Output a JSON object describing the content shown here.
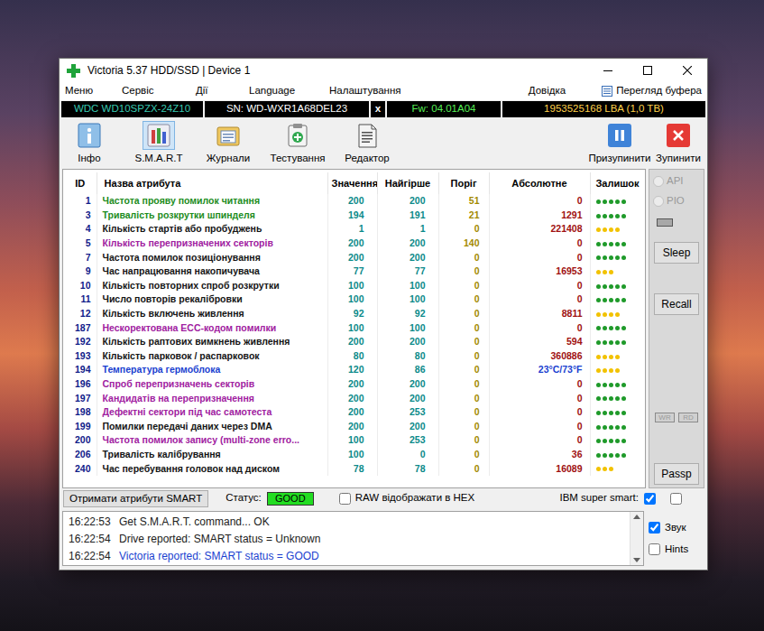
{
  "window": {
    "title": "Victoria 5.37 HDD/SSD | Device 1"
  },
  "menu": {
    "items": [
      "Меню",
      "Сервіс",
      "Дії",
      "Language",
      "Налаштування"
    ],
    "help": "Довідка",
    "buffer": "Перегляд буфера"
  },
  "device": {
    "model": "WDC WD10SPZX-24Z10",
    "serial": "SN: WD-WXR1A68DEL23",
    "close": "x",
    "firmware": "Fw: 04.01A04",
    "capacity": "1953525168 LBA (1,0 TB)"
  },
  "toolbar": {
    "left": [
      {
        "label": "Інфо",
        "selected": false,
        "kind": "info"
      },
      {
        "label": "S.M.A.R.T",
        "selected": true,
        "kind": "smart"
      },
      {
        "label": "Журнали",
        "selected": false,
        "kind": "journal"
      },
      {
        "label": "Тестування",
        "selected": false,
        "kind": "test"
      },
      {
        "label": "Редактор",
        "selected": false,
        "kind": "editor"
      }
    ],
    "right": [
      {
        "label": "Призупинити",
        "kind": "pause"
      },
      {
        "label": "Зупинити",
        "kind": "stop"
      }
    ]
  },
  "table": {
    "columns": [
      "ID",
      "Назва атрибута",
      "Значення",
      "Найгірше",
      "Поріг",
      "Абсолютне",
      "Залишок"
    ],
    "rows": [
      {
        "id": "1",
        "name": "Частота прояву помилок читання",
        "value": "200",
        "worst": "200",
        "threshold": "51",
        "raw": "0",
        "name_color": "#1c8c1c",
        "raw_color": "#a01010",
        "stars": 5,
        "dot_color": "#1f9a2a"
      },
      {
        "id": "3",
        "name": "Тривалість розкрутки шпинделя",
        "value": "194",
        "worst": "191",
        "threshold": "21",
        "raw": "1291",
        "name_color": "#1c8c1c",
        "raw_color": "#a01010",
        "stars": 5,
        "dot_color": "#1f9a2a"
      },
      {
        "id": "4",
        "name": "Кількість стартів або пробуджень",
        "value": "1",
        "worst": "1",
        "threshold": "0",
        "raw": "221408",
        "name_color": "#141414",
        "raw_color": "#a01010",
        "stars": 4,
        "dot_color": "#f2c200"
      },
      {
        "id": "5",
        "name": "Кількість перепризначених секторів",
        "value": "200",
        "worst": "200",
        "threshold": "140",
        "raw": "0",
        "name_color": "#a020a0",
        "raw_color": "#a01010",
        "stars": 5,
        "dot_color": "#1f9a2a"
      },
      {
        "id": "7",
        "name": "Частота помилок позиціонування",
        "value": "200",
        "worst": "200",
        "threshold": "0",
        "raw": "0",
        "name_color": "#141414",
        "raw_color": "#a01010",
        "stars": 5,
        "dot_color": "#1f9a2a"
      },
      {
        "id": "9",
        "name": "Час напрацювання накопичувача",
        "value": "77",
        "worst": "77",
        "threshold": "0",
        "raw": "16953",
        "name_color": "#141414",
        "raw_color": "#a01010",
        "stars": 3,
        "dot_color": "#f2c200"
      },
      {
        "id": "10",
        "name": "Кількість повторних спроб розкрутки",
        "value": "100",
        "worst": "100",
        "threshold": "0",
        "raw": "0",
        "name_color": "#141414",
        "raw_color": "#a01010",
        "stars": 5,
        "dot_color": "#1f9a2a"
      },
      {
        "id": "11",
        "name": "Число повторів рекалібровки",
        "value": "100",
        "worst": "100",
        "threshold": "0",
        "raw": "0",
        "name_color": "#141414",
        "raw_color": "#a01010",
        "stars": 5,
        "dot_color": "#1f9a2a"
      },
      {
        "id": "12",
        "name": "Кількість включень живлення",
        "value": "92",
        "worst": "92",
        "threshold": "0",
        "raw": "8811",
        "name_color": "#141414",
        "raw_color": "#a01010",
        "stars": 4,
        "dot_color": "#f2c200"
      },
      {
        "id": "187",
        "name": "Нескоректована ECC-кодом помилки",
        "value": "100",
        "worst": "100",
        "threshold": "0",
        "raw": "0",
        "name_color": "#a020a0",
        "raw_color": "#a01010",
        "stars": 5,
        "dot_color": "#1f9a2a"
      },
      {
        "id": "192",
        "name": "Кількість раптових вимкнень живлення",
        "value": "200",
        "worst": "200",
        "threshold": "0",
        "raw": "594",
        "name_color": "#141414",
        "raw_color": "#a01010",
        "stars": 5,
        "dot_color": "#1f9a2a"
      },
      {
        "id": "193",
        "name": "Кількість парковок / распарковок",
        "value": "80",
        "worst": "80",
        "threshold": "0",
        "raw": "360886",
        "name_color": "#141414",
        "raw_color": "#a01010",
        "stars": 4,
        "dot_color": "#f2c200"
      },
      {
        "id": "194",
        "name": "Температура гермоблока",
        "value": "120",
        "worst": "86",
        "threshold": "0",
        "raw": "23°C/73°F",
        "name_color": "#1a3fd0",
        "raw_color": "#1a3fd0",
        "stars": 4,
        "dot_color": "#f2c200"
      },
      {
        "id": "196",
        "name": "Спроб перепризначень секторів",
        "value": "200",
        "worst": "200",
        "threshold": "0",
        "raw": "0",
        "name_color": "#a020a0",
        "raw_color": "#a01010",
        "stars": 5,
        "dot_color": "#1f9a2a"
      },
      {
        "id": "197",
        "name": "Кандидатів на перепризначення",
        "value": "200",
        "worst": "200",
        "threshold": "0",
        "raw": "0",
        "name_color": "#a020a0",
        "raw_color": "#a01010",
        "stars": 5,
        "dot_color": "#1f9a2a"
      },
      {
        "id": "198",
        "name": "Дефектні сектори під час самотеста",
        "value": "200",
        "worst": "253",
        "threshold": "0",
        "raw": "0",
        "name_color": "#a020a0",
        "raw_color": "#a01010",
        "stars": 5,
        "dot_color": "#1f9a2a"
      },
      {
        "id": "199",
        "name": "Помилки передачі даних через DMA",
        "value": "200",
        "worst": "200",
        "threshold": "0",
        "raw": "0",
        "name_color": "#141414",
        "raw_color": "#a01010",
        "stars": 5,
        "dot_color": "#1f9a2a"
      },
      {
        "id": "200",
        "name": "Частота помилок запису (multi-zone erro...",
        "value": "100",
        "worst": "253",
        "threshold": "0",
        "raw": "0",
        "name_color": "#a020a0",
        "raw_color": "#a01010",
        "stars": 5,
        "dot_color": "#1f9a2a"
      },
      {
        "id": "206",
        "name": "Тривалість калібрування",
        "value": "100",
        "worst": "0",
        "threshold": "0",
        "raw": "36",
        "name_color": "#141414",
        "raw_color": "#a01010",
        "stars": 5,
        "dot_color": "#1f9a2a"
      },
      {
        "id": "240",
        "name": "Час перебування головок над диском",
        "value": "78",
        "worst": "78",
        "threshold": "0",
        "raw": "16089",
        "name_color": "#141414",
        "raw_color": "#a01010",
        "stars": 3,
        "dot_color": "#f2c200"
      }
    ]
  },
  "side": {
    "modes": [
      {
        "label": "API",
        "selected": false,
        "disabled": true
      },
      {
        "label": "PIO",
        "selected": false,
        "disabled": true
      }
    ],
    "buttons": [
      "Sleep",
      "Recall"
    ],
    "small": [
      {
        "label": "WR",
        "disabled": true
      },
      {
        "label": "RD",
        "disabled": true
      }
    ],
    "passp": "Passp"
  },
  "status_bar": {
    "button": "Отримати атрибути SMART",
    "status_label": "Статус:",
    "status": "GOOD",
    "status_color": "#22dd22",
    "hex": {
      "label": "RAW відображати в HEX",
      "checked": false
    },
    "ibm": {
      "label": "IBM super smart:",
      "checked": true
    },
    "extra": {
      "checked": false
    }
  },
  "log": {
    "rows": [
      {
        "time": "16:22:53",
        "message": "Get S.M.A.R.T. command... OK",
        "color": "#202020"
      },
      {
        "time": "16:22:54",
        "message": "Drive reported: SMART status = Unknown",
        "color": "#202020"
      },
      {
        "time": "16:22:54",
        "message": "Victoria reported: SMART status = GOOD",
        "color": "#1a3fd0"
      }
    ]
  },
  "log_options": [
    {
      "label": "Звук",
      "checked": true
    },
    {
      "label": "Hints",
      "checked": false
    }
  ]
}
